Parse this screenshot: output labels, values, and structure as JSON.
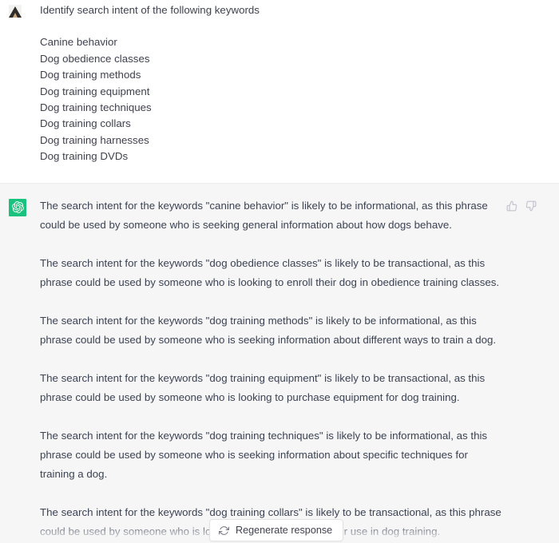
{
  "conversation": {
    "user_message": {
      "avatar_name": "user-avatar",
      "prompt": "Identify search intent of the following keywords",
      "keywords": [
        "Canine behavior",
        "Dog obedience classes",
        "Dog training methods",
        "Dog training equipment",
        "Dog training techniques",
        "Dog training collars",
        "Dog training harnesses",
        "Dog training DVDs"
      ]
    },
    "assistant_message": {
      "avatar_name": "chatgpt-avatar",
      "paragraphs": [
        "The search intent for the keywords \"canine behavior\" is likely to be informational, as this phrase could be used by someone who is seeking general information about how dogs behave.",
        "The search intent for the keywords \"dog obedience classes\" is likely to be transactional, as this phrase could be used by someone who is looking to enroll their dog in obedience training classes.",
        "The search intent for the keywords \"dog training methods\" is likely to be informational, as this phrase could be used by someone who is seeking information about different ways to train a dog.",
        "The search intent for the keywords \"dog training equipment\" is likely to be transactional, as this phrase could be used by someone who is looking to purchase equipment for dog training.",
        "The search intent for the keywords \"dog training techniques\" is likely to be informational, as this phrase could be used by someone who is seeking information about specific techniques for training a dog.",
        "The search intent for the keywords \"dog training collars\" is likely to be transactional, as this phrase could be used by someone who is looking to purchase a collar for use in dog training."
      ],
      "feedback": {
        "thumbs_up_label": "Good response",
        "thumbs_down_label": "Bad response"
      }
    }
  },
  "regenerate_button": {
    "label": "Regenerate response",
    "icon": "refresh-icon"
  },
  "colors": {
    "assistant_background": "#f6f6f7",
    "user_background": "#ffffff",
    "brand_green": "#19c37d",
    "text": "#3b4252",
    "icon_muted": "#c4c2ce"
  }
}
